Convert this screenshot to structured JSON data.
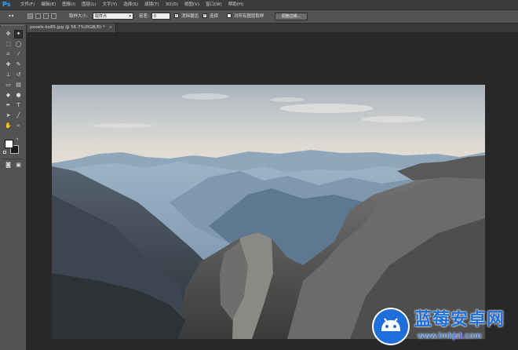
{
  "app": {
    "logo_text": "Ps"
  },
  "menu": [
    {
      "label": "文件(F)"
    },
    {
      "label": "编辑(E)"
    },
    {
      "label": "图像(I)"
    },
    {
      "label": "图层(L)"
    },
    {
      "label": "文字(Y)"
    },
    {
      "label": "选择(S)"
    },
    {
      "label": "滤镜(T)"
    },
    {
      "label": "3D(D)"
    },
    {
      "label": "视图(V)"
    },
    {
      "label": "窗口(W)"
    },
    {
      "label": "帮助(H)"
    }
  ],
  "options": {
    "sample_size_label": "取样大小:",
    "sample_size_value": "取样点",
    "tolerance_label": "容差:",
    "tolerance_value": "0",
    "anti_alias_label": "消除锯齿",
    "anti_alias_checked": true,
    "contiguous_label": "连续",
    "contiguous_checked": true,
    "sample_all_layers_label": "对所有图层取样",
    "sample_all_layers_checked": false,
    "refine_edge_label": "调整边缘..."
  },
  "document": {
    "tab_title": "pexels-ko85.jpg @ 56.7%(RGB/8) *",
    "close_glyph": "×"
  },
  "colors": {
    "foreground": "#ffffff",
    "background": "#1a1a1a",
    "ps_accent": "#31a8ff",
    "watermark_blue": "#1e6fd9"
  },
  "tools": [
    {
      "name": "move-tool-icon",
      "glyph": "✥"
    },
    {
      "name": "magic-wand-tool-icon",
      "glyph": "✦"
    },
    {
      "name": "marquee-tool-icon",
      "glyph": "⬚"
    },
    {
      "name": "lasso-tool-icon",
      "glyph": "◯"
    },
    {
      "name": "crop-tool-icon",
      "glyph": "⌗"
    },
    {
      "name": "eyedropper-tool-icon",
      "glyph": "⁄"
    },
    {
      "name": "healing-brush-tool-icon",
      "glyph": "✚"
    },
    {
      "name": "brush-tool-icon",
      "glyph": "✎"
    },
    {
      "name": "clone-stamp-tool-icon",
      "glyph": "⊥"
    },
    {
      "name": "history-brush-tool-icon",
      "glyph": "↺"
    },
    {
      "name": "eraser-tool-icon",
      "glyph": "▭"
    },
    {
      "name": "gradient-tool-icon",
      "glyph": "▤"
    },
    {
      "name": "blur-tool-icon",
      "glyph": "◆"
    },
    {
      "name": "dodge-tool-icon",
      "glyph": "●"
    },
    {
      "name": "pen-tool-icon",
      "glyph": "✒"
    },
    {
      "name": "type-tool-icon",
      "glyph": "T"
    },
    {
      "name": "path-selection-tool-icon",
      "glyph": "➤"
    },
    {
      "name": "line-tool-icon",
      "glyph": "╱"
    },
    {
      "name": "hand-tool-icon",
      "glyph": "✋"
    },
    {
      "name": "zoom-tool-icon",
      "glyph": "⌕"
    }
  ],
  "watermark": {
    "title": "蓝莓安卓网",
    "url": "www.lmkjst.com"
  }
}
